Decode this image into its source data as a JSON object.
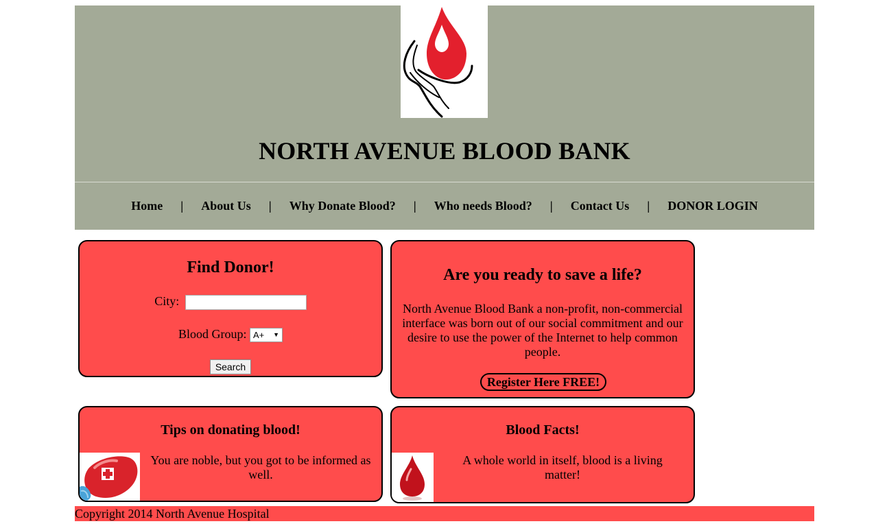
{
  "site": {
    "title": "NORTH AVENUE BLOOD BANK",
    "logo_icon": "blood-drop-hand-icon",
    "colors": {
      "header_bg": "#a3aa97",
      "card_bg": "#ff4c4c",
      "drop_red": "#e3202d"
    }
  },
  "nav": {
    "items": [
      {
        "label": "Home"
      },
      {
        "label": "About Us"
      },
      {
        "label": "Why Donate Blood?"
      },
      {
        "label": "Who needs Blood?"
      },
      {
        "label": "Contact Us"
      },
      {
        "label": "DONOR LOGIN"
      }
    ],
    "separator": "|"
  },
  "find_donor": {
    "heading": "Find Donor!",
    "city_label": "City:",
    "city_value": "",
    "blood_group_label": "Blood Group:",
    "blood_group_selected": "A+",
    "search_label": "Search"
  },
  "ready": {
    "heading": "Are you ready to save a life?",
    "text": "North Avenue Blood Bank a non-profit, non-commercial interface was born out of our social commitment and our desire to use the power of the Internet to help common people.",
    "register_label": "Register Here FREE!"
  },
  "tips": {
    "heading": "Tips on donating blood!",
    "text": "You are noble, but you got to be informed as well.",
    "image_icon": "blood-bag-icon"
  },
  "facts": {
    "heading": "Blood Facts!",
    "text": "A whole world in itself, blood is a living matter!",
    "image_icon": "blood-drop-icon"
  },
  "footer": {
    "text": "Copyright 2014 North Avenue Hospital"
  }
}
